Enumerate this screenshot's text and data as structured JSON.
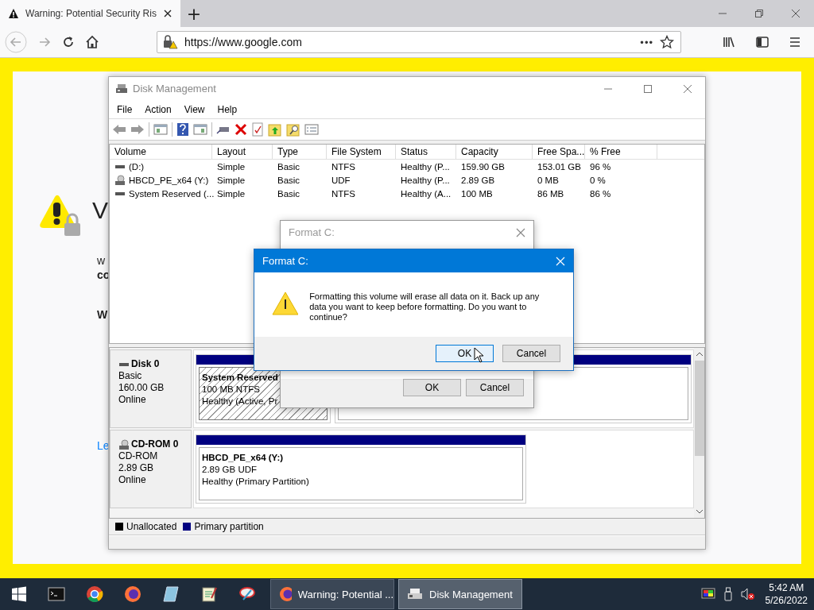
{
  "browser": {
    "tabs": [
      {
        "title": "Warning: Potential Security Ris",
        "selected": true
      }
    ],
    "new_tab": "+",
    "url": "https://www.google.com",
    "more": "•••",
    "page": {
      "heading": "V",
      "lines": [
        {
          "text": "w",
          "kind": "plain"
        },
        {
          "text": "co",
          "kind": "bold"
        },
        {
          "text": "W",
          "kind": "bold"
        },
        {
          "text": "Le",
          "kind": "link"
        }
      ]
    }
  },
  "disk_management": {
    "title": "Disk Management",
    "menu": [
      "File",
      "Action",
      "View",
      "Help"
    ],
    "columns": [
      "Volume",
      "Layout",
      "Type",
      "File System",
      "Status",
      "Capacity",
      "Free Spa...",
      "% Free"
    ],
    "rows": [
      {
        "kind": "hdd",
        "cells": [
          "(D:)",
          "Simple",
          "Basic",
          "NTFS",
          "Healthy (P...",
          "159.90 GB",
          "153.01 GB",
          "96 %"
        ]
      },
      {
        "kind": "cd",
        "cells": [
          "HBCD_PE_x64 (Y:)",
          "Simple",
          "Basic",
          "UDF",
          "Healthy (P...",
          "2.89 GB",
          "0 MB",
          "0 %"
        ]
      },
      {
        "kind": "hdd",
        "cells": [
          "System Reserved (...",
          "Simple",
          "Basic",
          "NTFS",
          "Healthy (A...",
          "100 MB",
          "86 MB",
          "86 %"
        ]
      }
    ],
    "disks": [
      {
        "kind": "hdd",
        "name": "Disk 0",
        "type": "Basic",
        "size": "160.00 GB",
        "status": "Online",
        "partitions": [
          {
            "name": "System Reserved",
            "detail": "100 MB NTFS",
            "status": "Healthy (Active, Pr",
            "selected": true
          },
          {
            "selected": false
          }
        ]
      },
      {
        "kind": "cd",
        "name": "CD-ROM 0",
        "type": "CD-ROM",
        "size": "2.89 GB",
        "status": "Online",
        "partitions": [
          {
            "name": "HBCD_PE_x64  (Y:)",
            "detail": "2.89 GB UDF",
            "status": "Healthy (Primary Partition)",
            "selected": false
          }
        ]
      }
    ],
    "legend": [
      {
        "label": "Unallocated",
        "color": "#000000"
      },
      {
        "label": "Primary partition",
        "color": "#000080"
      }
    ]
  },
  "dialogs": [
    {
      "title": "Format C:",
      "active": false,
      "buttons": [
        {
          "label": "OK",
          "focused": false
        },
        {
          "label": "Cancel",
          "focused": false
        }
      ]
    },
    {
      "title": "Format C:",
      "active": true,
      "message": "Formatting this volume will erase all data on it. Back up any data you want to keep before formatting. Do you want to continue?",
      "buttons": [
        {
          "label": "OK",
          "focused": true
        },
        {
          "label": "Cancel",
          "focused": false
        }
      ]
    }
  ],
  "taskbar": {
    "windows": [
      {
        "title": "Warning: Potential ...",
        "kind": "browser",
        "selected": false
      },
      {
        "title": "Disk Management",
        "kind": "disk",
        "selected": true
      }
    ],
    "time": "5:42 AM",
    "date": "5/26/2022"
  }
}
